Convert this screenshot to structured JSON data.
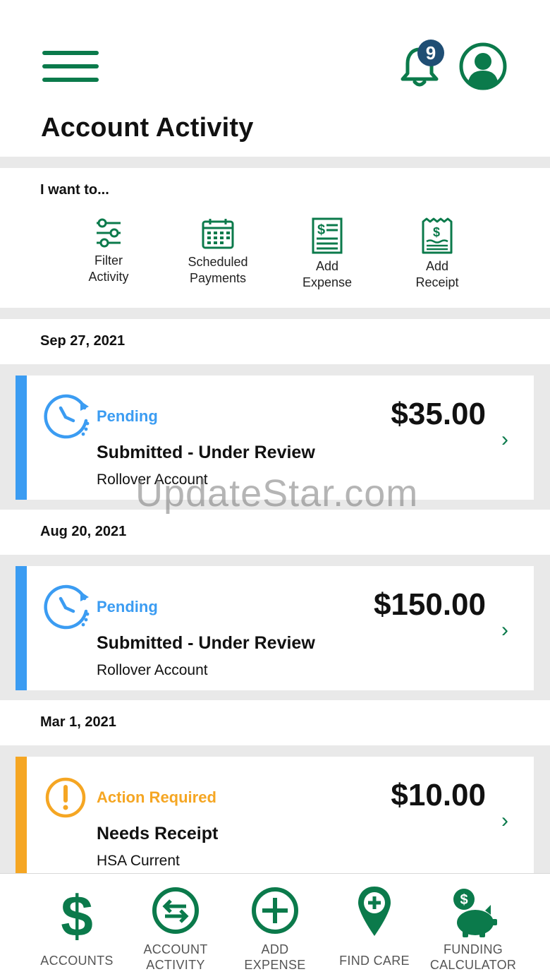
{
  "header": {
    "title": "Account Activity",
    "notification_count": "9"
  },
  "iwant": {
    "title": "I want to...",
    "actions": [
      {
        "label": "Filter\nActivity"
      },
      {
        "label": "Scheduled\nPayments"
      },
      {
        "label": "Add\nExpense"
      },
      {
        "label": "Add\nReceipt"
      }
    ]
  },
  "activity": [
    {
      "date": "Sep 27, 2021",
      "status": "Pending",
      "amount": "$35.00",
      "title": "Submitted - Under Review",
      "account": "Rollover Account",
      "chevron": "›"
    },
    {
      "date": "Aug 20, 2021",
      "status": "Pending",
      "amount": "$150.00",
      "title": "Submitted - Under Review",
      "account": "Rollover Account",
      "chevron": "›"
    },
    {
      "date": "Mar 1, 2021",
      "status": "Action Required",
      "amount": "$10.00",
      "title": "Needs Receipt",
      "account": "HSA Current",
      "chevron": "›"
    }
  ],
  "watermark": "UpdateStar.com",
  "bottom_nav": [
    {
      "label": "ACCOUNTS",
      "icon": "dollar-icon"
    },
    {
      "label": "ACCOUNT\nACTIVITY",
      "icon": "exchange-icon"
    },
    {
      "label": "ADD\nEXPENSE",
      "icon": "plus-circle-icon"
    },
    {
      "label": "FIND CARE",
      "icon": "map-pin-plus-icon"
    },
    {
      "label": "FUNDING\nCALCULATOR",
      "icon": "piggy-bank-icon"
    }
  ],
  "colors": {
    "brand_green": "#0b7a4b",
    "pending_blue": "#3b9cf2",
    "action_orange": "#f5a623",
    "badge_navy": "#1f4e74"
  }
}
